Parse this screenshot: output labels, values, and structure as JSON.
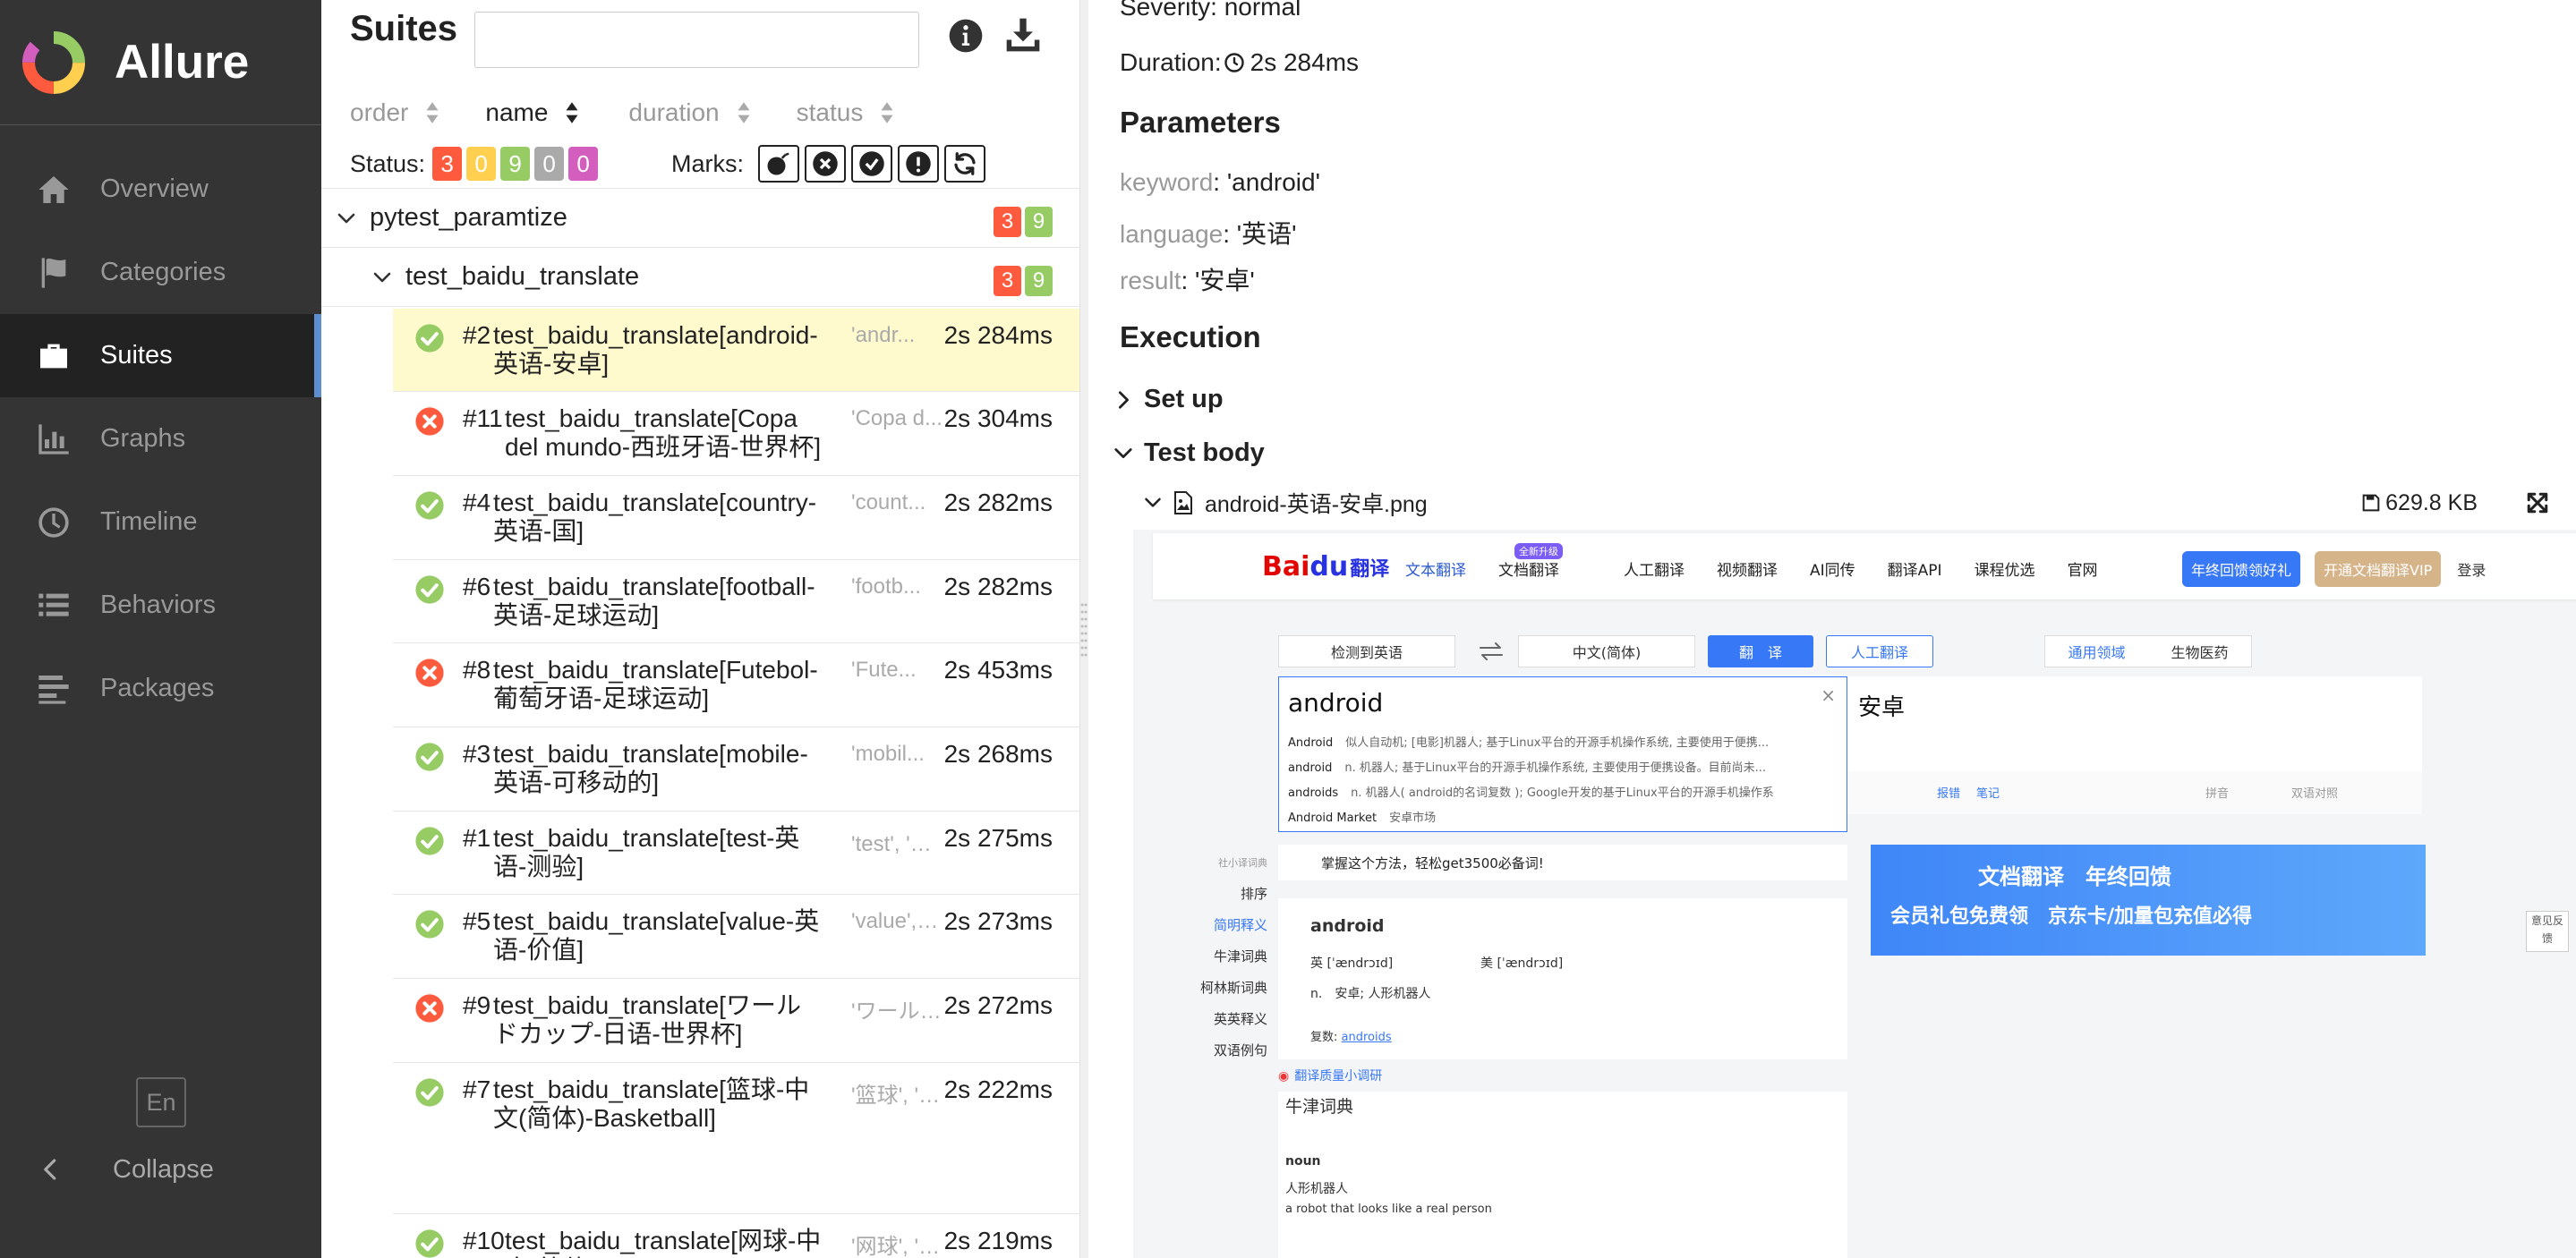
{
  "colors": {
    "failed": "#fd5a3e",
    "broken": "#ffd050",
    "passed": "#97cc64",
    "skipped": "#aaaaaa",
    "unknown": "#d35ebe",
    "sidebar_bg": "#343434",
    "selected_row": "#fffacd",
    "accent": "#5c8ed1"
  },
  "app": {
    "name": "Allure"
  },
  "sidebar": {
    "items": [
      {
        "label": "Overview",
        "icon": "home-icon",
        "active": false
      },
      {
        "label": "Categories",
        "icon": "flag-icon",
        "active": false
      },
      {
        "label": "Suites",
        "icon": "briefcase-icon",
        "active": true
      },
      {
        "label": "Graphs",
        "icon": "bar-chart-icon",
        "active": false
      },
      {
        "label": "Timeline",
        "icon": "clock-icon",
        "active": false
      },
      {
        "label": "Behaviors",
        "icon": "list-icon",
        "active": false
      },
      {
        "label": "Packages",
        "icon": "align-left-icon",
        "active": false
      }
    ],
    "language": "En",
    "collapse": "Collapse"
  },
  "suites": {
    "title": "Suites",
    "search_value": "",
    "sorters": [
      {
        "label": "order",
        "selected": false
      },
      {
        "label": "name",
        "selected": true
      },
      {
        "label": "duration",
        "selected": false
      },
      {
        "label": "status",
        "selected": false
      }
    ],
    "status_label": "Status:",
    "status_counts": [
      "3",
      "0",
      "9",
      "0",
      "0"
    ],
    "marks_label": "Marks:",
    "tree": {
      "root": {
        "name": "pytest_paramtize",
        "failed": "3",
        "passed": "9"
      },
      "child": {
        "name": "test_baidu_translate",
        "failed": "3",
        "passed": "9"
      }
    },
    "tests": [
      {
        "order": "#2",
        "name": "test_baidu_translate[android-英语-安卓]",
        "params": "'andr...",
        "duration": "2s 284ms",
        "status": "passed",
        "selected": true
      },
      {
        "order": "#11",
        "name": "test_baidu_translate[Copa del mundo-西班牙语-世界杯]",
        "params": "'Copa d...",
        "duration": "2s 304ms",
        "status": "failed",
        "selected": false
      },
      {
        "order": "#4",
        "name": "test_baidu_translate[country-英语-国]",
        "params": "'count...",
        "duration": "2s 282ms",
        "status": "passed",
        "selected": false
      },
      {
        "order": "#6",
        "name": "test_baidu_translate[football-英语-足球运动]",
        "params": "'footb...",
        "duration": "2s 282ms",
        "status": "passed",
        "selected": false
      },
      {
        "order": "#8",
        "name": "test_baidu_translate[Futebol-葡萄牙语-足球运动]",
        "params": "'Fute...",
        "duration": "2s 453ms",
        "status": "failed",
        "selected": false
      },
      {
        "order": "#3",
        "name": "test_baidu_translate[mobile-英语-可移动的]",
        "params": "'mobil...",
        "duration": "2s 268ms",
        "status": "passed",
        "selected": false
      },
      {
        "order": "#1",
        "name": "test_baidu_translate[test-英语-测验]",
        "params": "'test', '英...",
        "duration": "2s 275ms",
        "status": "passed",
        "selected": false
      },
      {
        "order": "#5",
        "name": "test_baidu_translate[value-英语-价值]",
        "params": "'value', '...",
        "duration": "2s 273ms",
        "status": "passed",
        "selected": false
      },
      {
        "order": "#9",
        "name": "test_baidu_translate[ワールドカップ-日语-世界杯]",
        "params": "'ワールド...",
        "duration": "2s 272ms",
        "status": "failed",
        "selected": false
      },
      {
        "order": "#7",
        "name": "test_baidu_translate[篮球-中文(简体)-Basketball]",
        "params": "'篮球', '中文...",
        "duration": "2s 222ms",
        "status": "passed",
        "selected": false
      },
      {
        "order": "#10",
        "name": "test_baidu_translate[网球-中文(简体)-Tennis]",
        "params": "'网球', '中...",
        "duration": "2s 219ms",
        "status": "passed",
        "selected": false
      }
    ]
  },
  "detail": {
    "severity": "Severity: normal",
    "duration": "Duration: ",
    "duration_value": "2s 284ms",
    "parameters_heading": "Parameters",
    "parameters": [
      {
        "key": "keyword",
        "value": ": 'android'"
      },
      {
        "key": "language",
        "value": ": '英语'"
      },
      {
        "key": "result",
        "value": ": '安卓'"
      }
    ],
    "execution_heading": "Execution",
    "setup": "Set up",
    "test_body": "Test body",
    "attachment": {
      "name": "android-英语-安卓.png",
      "size": "629.8 KB"
    }
  },
  "screenshot": {
    "logo_a": "Bai",
    "logo_b": "du",
    "logo_c": "翻译",
    "nav_links": [
      "文本翻译",
      "文档翻译",
      "人工翻译",
      "视频翻译",
      "AI同传",
      "翻译API",
      "课程优选",
      "官网"
    ],
    "new_tag": "全新升级",
    "promo_blue": "年终回馈领好礼",
    "promo_gold": "开通文档翻译VIP",
    "login": "登录",
    "detect": "检测到英语",
    "target_lang": "中文(简体)",
    "translate_btn": "翻　译",
    "human_btn": "人工翻译",
    "domain_general": "通用领域",
    "domain_bio": "生物医药",
    "input": "android",
    "output": "安卓",
    "suggestions": [
      {
        "w": "Android",
        "d": "似人自动机; [电影]机器人; 基于Linux平台的开源手机操作系统, 主要使用于便携..."
      },
      {
        "w": "android",
        "d": "n. 机器人; 基于Linux平台的开源手机操作系统, 主要使用于便携设备。目前尚未..."
      },
      {
        "w": "androids",
        "d": "n. 机器人( android的名词复数 ); Google开发的基于Linux平台的开源手机操作系"
      },
      {
        "w": "Android Market",
        "d": "安卓市场"
      }
    ],
    "tgt_tools": [
      "报错",
      "笔记",
      "拼音",
      "双语对照"
    ],
    "tip": "掌握这个方法，轻松get3500必备词!",
    "banner_a": "文档翻译",
    "banner_b": "年终回馈",
    "banner_c": "会员礼包免费领　京东卡/加量包充值必得",
    "dict_nav": [
      "社小译词典",
      "排序",
      "简明释义",
      "牛津词典",
      "柯林斯词典",
      "英英释义",
      "双语例句"
    ],
    "word": "android",
    "phon_uk": "英 [ˈændrɔɪd]",
    "phon_us": "美 [ˈændrɔɪd]",
    "meaning": "n.　安卓; 人形机器人",
    "plural": "复数:",
    "plural_word": "androids",
    "survey": "翻译质量小调研",
    "oxford": "牛津词典",
    "pos": "noun",
    "ox_def": "人形机器人",
    "ox_en": "a robot that looks like a real person",
    "feedback": "意见反馈"
  }
}
